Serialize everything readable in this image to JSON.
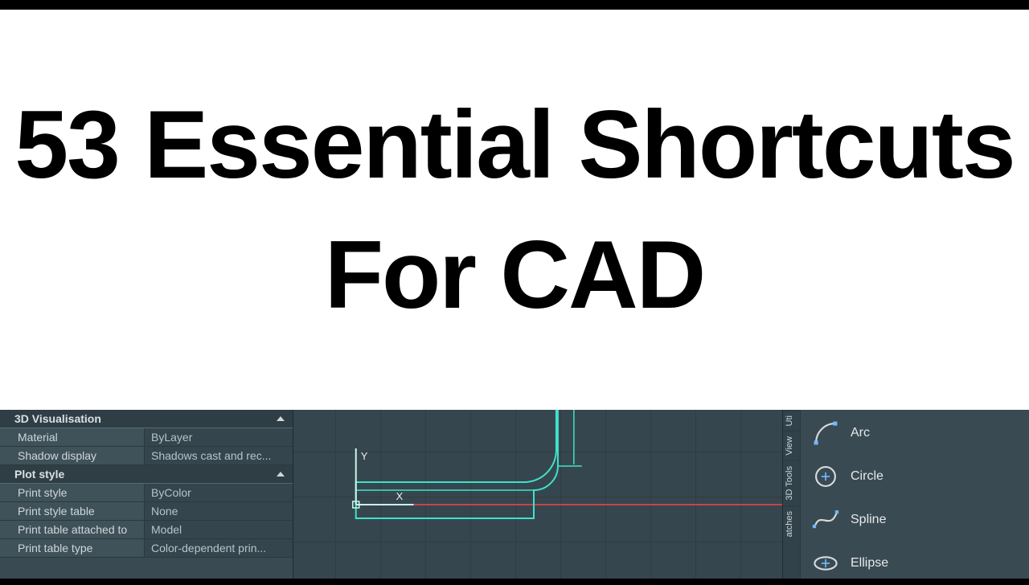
{
  "title_text": "53  Essential Shortcuts For CAD",
  "props": {
    "sections": [
      {
        "title": "3D Visualisation",
        "rows": [
          {
            "label": "Material",
            "value": "ByLayer"
          },
          {
            "label": "Shadow display",
            "value": "Shadows cast and rec..."
          }
        ]
      },
      {
        "title": "Plot style",
        "rows": [
          {
            "label": "Print style",
            "value": "ByColor"
          },
          {
            "label": "Print style table",
            "value": "None"
          },
          {
            "label": "Print table attached to",
            "value": "Model"
          },
          {
            "label": "Print table type",
            "value": "Color-dependent prin..."
          }
        ]
      }
    ]
  },
  "canvas": {
    "axis_labels": {
      "x": "X",
      "y": "Y"
    }
  },
  "vtabs": [
    "Uti",
    "View",
    "3D Tools",
    "atches"
  ],
  "tools": [
    {
      "name": "arc",
      "label": "Arc"
    },
    {
      "name": "circle",
      "label": "Circle"
    },
    {
      "name": "spline",
      "label": "Spline"
    },
    {
      "name": "ellipse",
      "label": "Ellipse"
    }
  ],
  "colors": {
    "cyan": "#3fe2c9",
    "red": "#c8424a",
    "iconBlue": "#6fb7ff",
    "iconGrey": "#d7dbdd"
  }
}
